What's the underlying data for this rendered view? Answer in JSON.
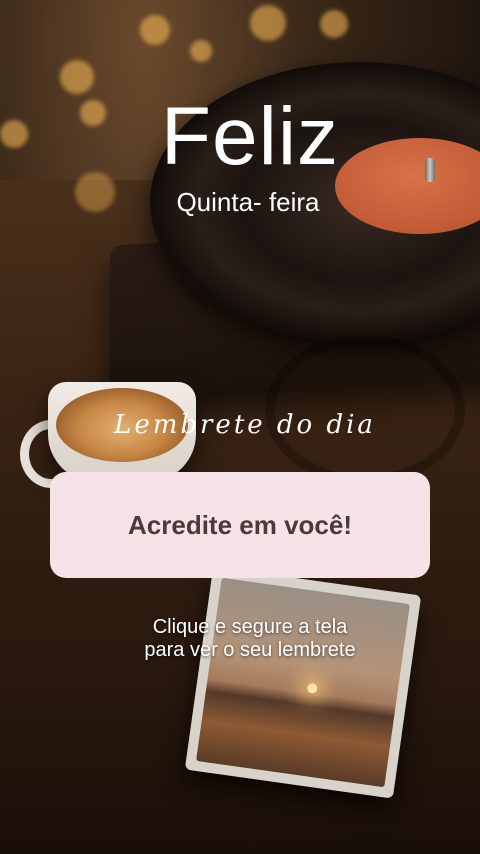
{
  "greeting": {
    "title": "Feliz",
    "subtitle": "Quinta- feira"
  },
  "reminder": {
    "heading": "Lembrete do dia",
    "message": "Acredite em você!",
    "hint_line1": "Clique e segure a tela",
    "hint_line2": "para ver o seu lembrete"
  },
  "colors": {
    "reminder_box": "#f5e3e8",
    "reminder_text": "#4a3a3a",
    "text_light": "#ffffff"
  }
}
